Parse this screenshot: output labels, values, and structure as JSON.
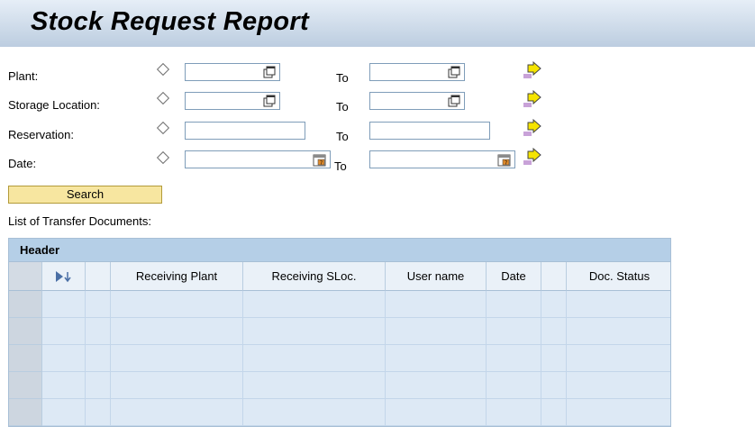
{
  "page": {
    "title": "Stock Request Report"
  },
  "filters": {
    "to_label": "To",
    "rows": [
      {
        "label": "Plant:",
        "from_value": "",
        "to_value": "",
        "helper": "copy-icon"
      },
      {
        "label": "Storage Location:",
        "from_value": "",
        "to_value": "",
        "helper": "copy-icon"
      },
      {
        "label": "Reservation:",
        "from_value": "",
        "to_value": "",
        "helper": "none"
      },
      {
        "label": "Date:",
        "from_value": "",
        "to_value": "",
        "helper": "calendar-icon"
      }
    ]
  },
  "search": {
    "label": "Search"
  },
  "list": {
    "label": "List of Transfer Documents:",
    "header": "Header",
    "columns": [
      "",
      "Receiving Plant",
      "Receiving SLoc.",
      "User name",
      "Date",
      "",
      "Doc. Status"
    ],
    "rows": [
      [
        "",
        "",
        "",
        "",
        "",
        "",
        ""
      ],
      [
        "",
        "",
        "",
        "",
        "",
        "",
        ""
      ],
      [
        "",
        "",
        "",
        "",
        "",
        "",
        ""
      ],
      [
        "",
        "",
        "",
        "",
        "",
        "",
        ""
      ],
      [
        "",
        "",
        "",
        "",
        "",
        "",
        ""
      ]
    ]
  },
  "colors": {
    "title_bar": "#cfdcea",
    "search_button": "#f7e6a0",
    "grid_header": "#b5cfe7",
    "grid_body": "#dde9f5",
    "arrow": "#f5e400"
  }
}
